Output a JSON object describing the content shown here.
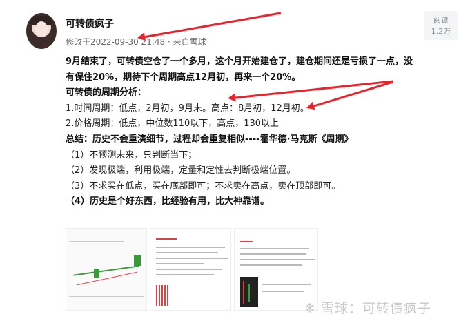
{
  "author": {
    "name": "可转债疯子"
  },
  "meta": {
    "modified": "修改于2022-09-30 21:48",
    "source": "· 来自雪球"
  },
  "reads": {
    "label": "阅读",
    "count": "1.2万"
  },
  "post": {
    "lines": [
      "9月结束了，可转债空仓了一个多月，这个月开始建仓了，建仓期间还是亏损了一点，没",
      "有保住20%，期待下个周期高点12月初，再来一个20%。",
      "可转债的周期分析：",
      "1.时间周期：低点，2月初，9月末。高点：8月初，12月初。",
      "2.价格周期：低点，中位数110以下，高点，130以上",
      "总结：历史不会重演细节，过程却会重复相似----霍华德·马克斯《周期》",
      "（1）不预测未来，只判断当下；",
      "（2）发现极端，利用极端，定量和定性去判断极端位置。",
      "（3）不求买在低点，买在底部即可；不求卖在高点，卖在顶部即可。",
      "（4）历史是个好东西，比经验有用，比大神靠谱。"
    ]
  },
  "watermark": "雪球：可转债疯子",
  "colors": {
    "accent": "#e8242a",
    "meta": "#666666"
  },
  "icons": [
    "avatar-image",
    "red-arrow-annotation",
    "snowball-logo-icon"
  ]
}
